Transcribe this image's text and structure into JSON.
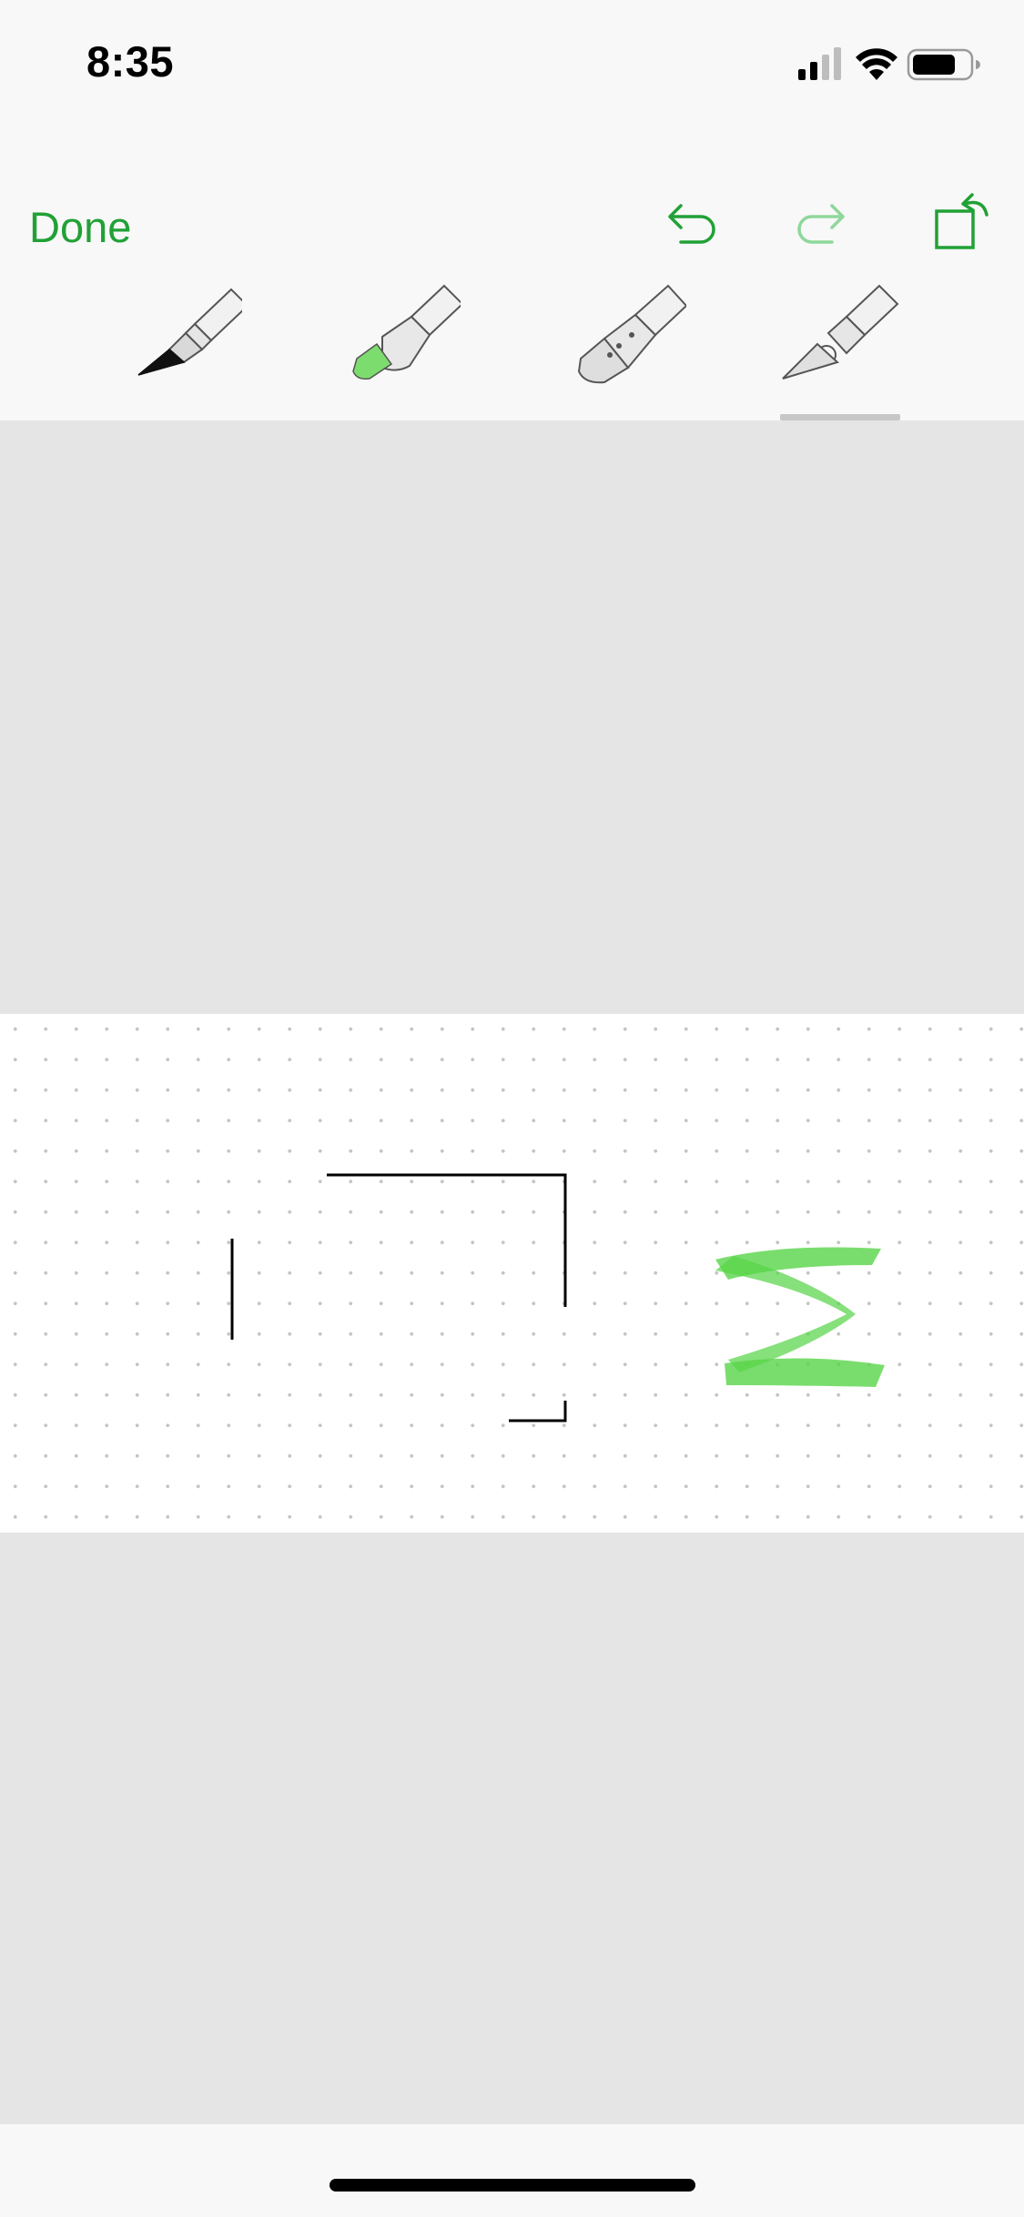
{
  "status_bar": {
    "time": "8:35",
    "icons": [
      "cellular-signal-icon",
      "wifi-icon",
      "battery-icon"
    ]
  },
  "toolbar": {
    "done_label": "Done",
    "actions": [
      "undo-icon",
      "redo-icon",
      "rotate-canvas-icon"
    ],
    "tools": [
      {
        "name": "pen",
        "tip_color": "#111111"
      },
      {
        "name": "highlighter",
        "tip_color": "#7ddc6e"
      },
      {
        "name": "eraser"
      },
      {
        "name": "lasso-cutter",
        "selected": true
      }
    ]
  },
  "colors": {
    "accent": "#21a136",
    "accent_disabled": "#8fd79b",
    "canvas_background": "#e5e5e5",
    "page_background": "#ffffff",
    "stroke_black": "#000000",
    "stroke_highlight": "#58d448"
  },
  "canvas": {
    "strokes": [
      "black-vertical-line",
      "black-rectangle-corner-top",
      "black-rectangle-corner-bottom",
      "green-highlighter-zigzag"
    ]
  }
}
